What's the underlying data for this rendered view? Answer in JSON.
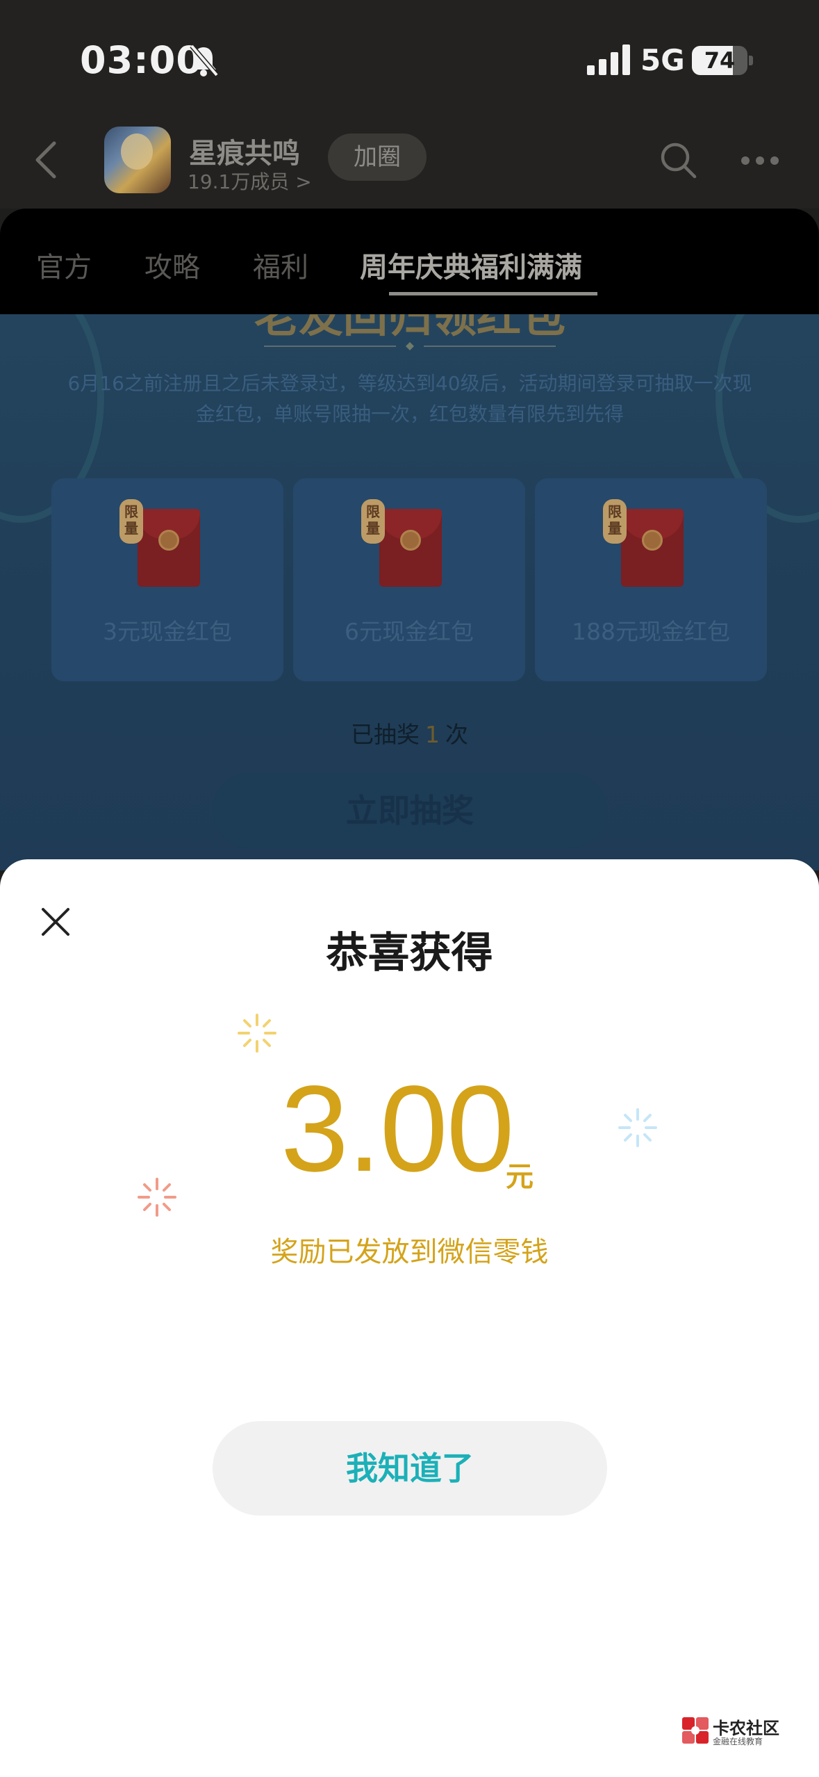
{
  "status_bar": {
    "time": "03:00",
    "network": "5G",
    "battery": "74",
    "battery_level": 0.74
  },
  "header": {
    "circle_name": "星痕共鸣",
    "members": "19.1万成员 >",
    "join_label": "加圈"
  },
  "tabs": [
    {
      "label": "官方"
    },
    {
      "label": "攻略"
    },
    {
      "label": "福利"
    },
    {
      "label": "周年庆典福利满满",
      "active": true
    }
  ],
  "event": {
    "title": "老友回归领红包",
    "description": "6月16之前注册且之后未登录过，等级达到40级后，活动期间登录可抽取一次现金红包，单账号限抽一次，红包数量有限先到先得",
    "badge": "限量",
    "prizes": [
      {
        "label": "3元现金红包"
      },
      {
        "label": "6元现金红包"
      },
      {
        "label": "188元现金红包"
      }
    ],
    "draw_count_prefix": "已抽奖",
    "draw_count": "1",
    "draw_count_suffix": "次",
    "draw_button": "立即抽奖"
  },
  "modal": {
    "title": "恭喜获得",
    "amount": "3.00",
    "currency": "元",
    "note": "奖励已发放到微信零钱",
    "confirm_button": "我知道了"
  },
  "watermark": {
    "name": "卡农社区",
    "tagline": "金融在线教育"
  },
  "colors": {
    "gold": "#d4a31a",
    "teal": "#1cb0b8",
    "sheet_bg": "#ffffff"
  }
}
